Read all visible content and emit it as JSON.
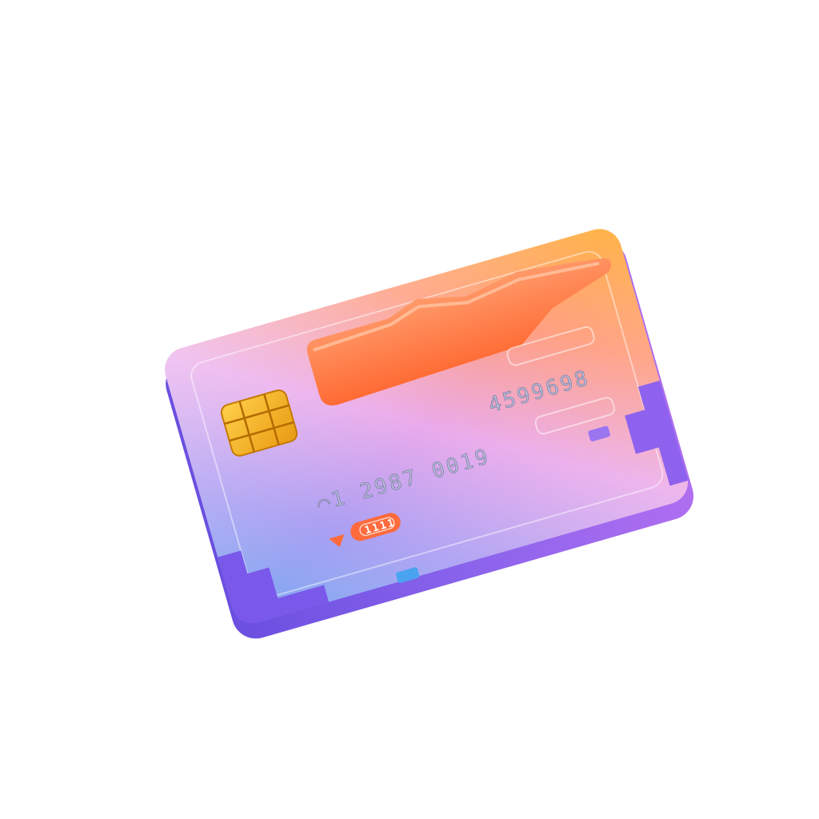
{
  "card": {
    "number_left": "⌒1 2987 0019",
    "number_right": "4599698",
    "tag_label": "1111"
  },
  "colors": {
    "background": "#ffffff",
    "card_purple": "#8b6cf0",
    "card_pink": "#f2a3e6",
    "card_orange": "#ff8a5c",
    "card_yellow": "#ffb347",
    "chip_gold": "#f6b11f",
    "stripe_orange": "#ff7a45",
    "tag_orange": "#ff6b3d",
    "accent_blue": "#4aa3f0"
  }
}
